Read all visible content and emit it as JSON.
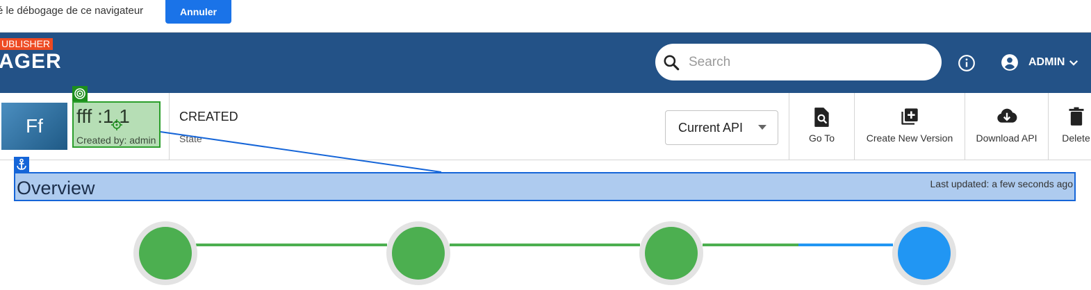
{
  "debug_bar": {
    "message": "é le débogage de ce navigateur",
    "cancel_label": "Annuler"
  },
  "header": {
    "badge": "UBLISHER",
    "brand": "AGER",
    "search_placeholder": "Search",
    "user_name": "ADMIN",
    "colors": {
      "bar": "#235287",
      "badge": "#ee4a22"
    }
  },
  "api": {
    "thumbnail_initials": "Ff",
    "name": "fff :1.1",
    "created_by": "Created by: admin",
    "state_value": "CREATED",
    "state_label": "State",
    "version_select": "Current API"
  },
  "toolbar": [
    {
      "label": "Go To",
      "icon": "search-document-icon"
    },
    {
      "label": "Create New Version",
      "icon": "add-copy-icon"
    },
    {
      "label": "Download API",
      "icon": "cloud-download-icon"
    },
    {
      "label": "Delete",
      "icon": "trash-icon"
    }
  ],
  "overview": {
    "title": "Overview",
    "last_updated": "Last updated: a few seconds ago"
  },
  "lifecycle": {
    "steps": [
      {
        "status": "complete",
        "color": "#4caf50"
      },
      {
        "status": "complete",
        "color": "#4caf50"
      },
      {
        "status": "complete",
        "color": "#4caf50"
      },
      {
        "status": "current",
        "color": "#2196f3"
      }
    ]
  }
}
